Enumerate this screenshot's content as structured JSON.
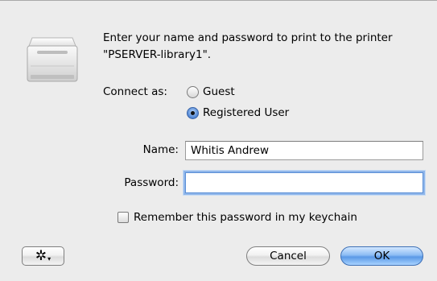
{
  "message": "Enter your name and password to print to the printer \"PSERVER-library1\".",
  "connect_as": {
    "label": "Connect as:",
    "options": [
      "Guest",
      "Registered User"
    ],
    "selected": "Registered User"
  },
  "name": {
    "label": "Name:",
    "value": "Whitis Andrew"
  },
  "password": {
    "label": "Password:",
    "value": ""
  },
  "remember": {
    "label": "Remember this password in my keychain",
    "checked": false
  },
  "buttons": {
    "action_icon": "gear-icon",
    "cancel": "Cancel",
    "ok": "OK"
  }
}
